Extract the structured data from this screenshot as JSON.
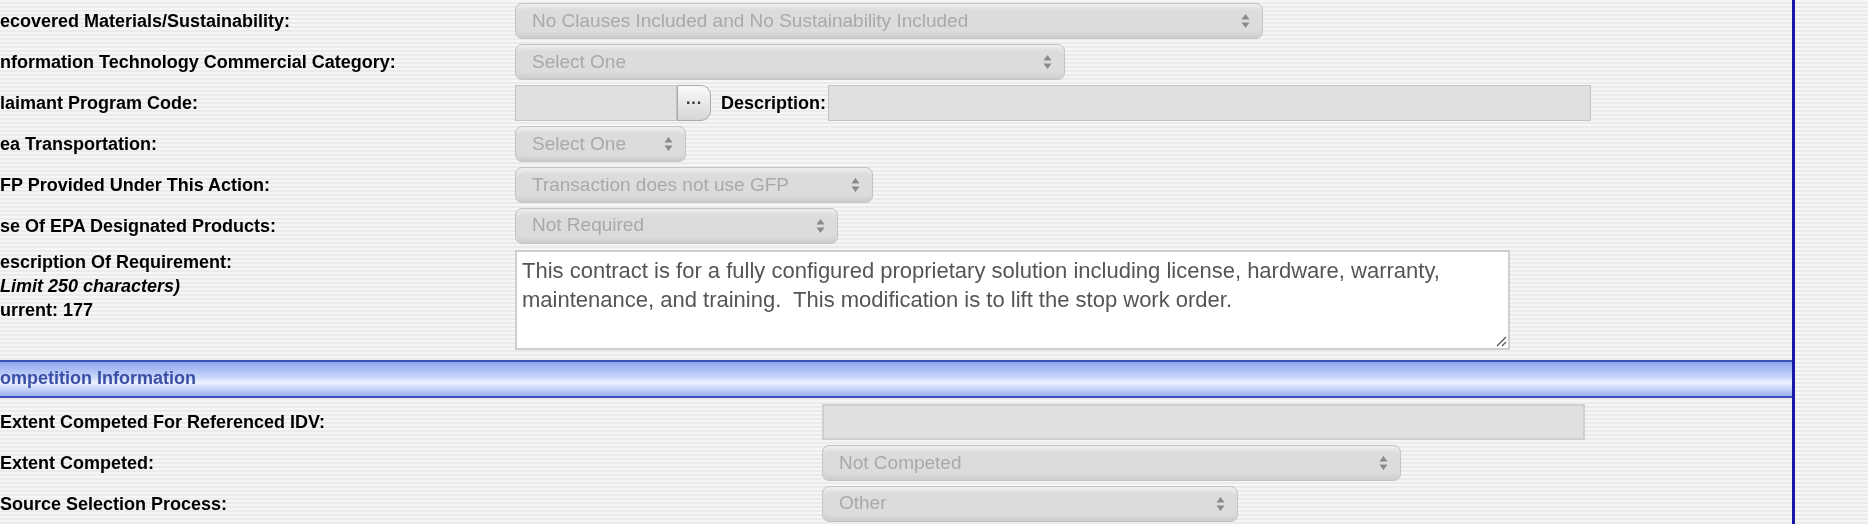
{
  "sections": [
    {
      "rows": [
        {
          "label": "ecovered Materials/Sustainability:",
          "kind": "select",
          "value": "No Clauses Included and No Sustainability Included",
          "disabled": true
        },
        {
          "label": "nformation Technology Commercial Category:",
          "kind": "select",
          "value": "Select One",
          "disabled": true
        },
        {
          "label": "laimant Program Code:",
          "kind": "lookup",
          "disabled": true,
          "button": "···",
          "description_label": "Description:"
        },
        {
          "label": "ea Transportation:",
          "kind": "select",
          "value": "Select One",
          "disabled": true
        },
        {
          "label": "FP Provided Under This Action:",
          "kind": "select",
          "value": "Transaction does not use GFP",
          "disabled": true
        },
        {
          "label": "se Of EPA Designated Products:",
          "kind": "select",
          "value": "Not Required",
          "disabled": true
        },
        {
          "label": "escription Of Requirement:",
          "kind": "textarea",
          "hint": "Limit 250 characters)",
          "count": "urrent: 177",
          "value": "This contract is for a fully configured proprietary solution including license, hardware, warranty, maintenance, and training.  This modification is to lift the stop work order.",
          "disabled": false
        }
      ]
    },
    {
      "header": "ompetition Information",
      "rows": [
        {
          "label": "Extent Competed For Referenced IDV:",
          "kind": "text",
          "disabled": true
        },
        {
          "label": "Extent Competed:",
          "kind": "select",
          "value": "Not Competed",
          "disabled": true
        },
        {
          "label": "Source Selection Process:",
          "kind": "select",
          "value": "Other",
          "disabled": true
        }
      ]
    }
  ]
}
